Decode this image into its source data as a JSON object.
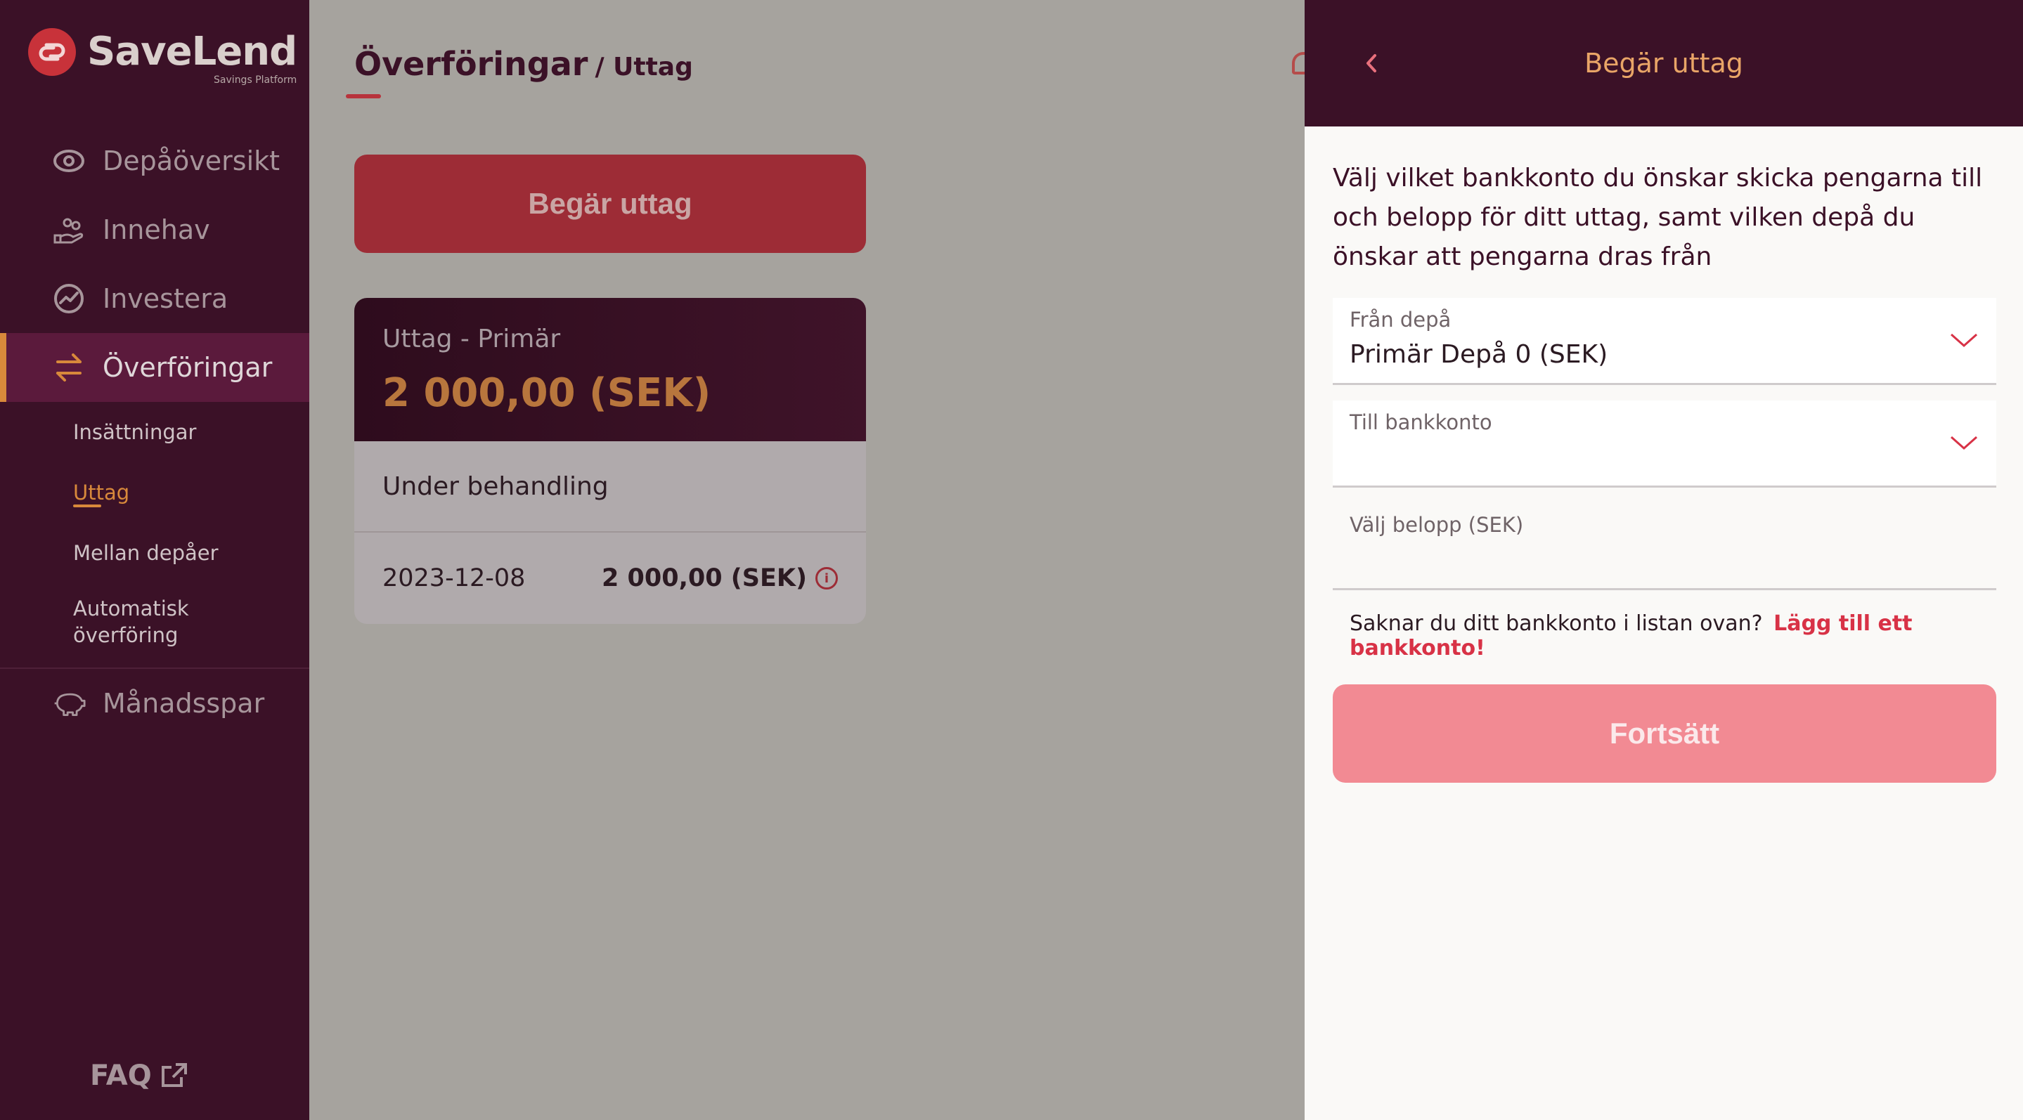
{
  "brand": {
    "name": "SaveLend",
    "tagline": "Savings Platform"
  },
  "sidebar": {
    "items": [
      {
        "label": "Depåöversikt",
        "icon": "eye-icon"
      },
      {
        "label": "Innehav",
        "icon": "hand-coins-icon"
      },
      {
        "label": "Investera",
        "icon": "trend-chart-icon"
      },
      {
        "label": "Överföringar",
        "icon": "transfer-arrows-icon",
        "active": true
      }
    ],
    "subitems": [
      {
        "label": "Insättningar"
      },
      {
        "label": "Uttag",
        "active": true
      },
      {
        "label": "Mellan depåer"
      },
      {
        "label": "Automatisk överföring"
      }
    ],
    "extra_item": {
      "label": "Månadsspar",
      "icon": "piggy-bank-icon"
    },
    "faq": {
      "label": "FAQ",
      "icon": "external-link-icon"
    }
  },
  "main": {
    "breadcrumb": {
      "section": "Överföringar",
      "page": "/ Uttag"
    },
    "request_button": "Begär uttag",
    "card": {
      "title": "Uttag - Primär",
      "amount": "2 000,00 (SEK)",
      "status": "Under behandling",
      "date": "2023-12-08",
      "value": "2 000,00 (SEK)"
    }
  },
  "panel": {
    "title": "Begär uttag",
    "intro": "Välj vilket bankkonto du önskar skicka pengarna till och belopp för ditt uttag, samt vilken depå du önskar att pengarna dras från",
    "from_label": "Från depå",
    "from_value": "Primär Depå 0 (SEK)",
    "to_label": "Till bankkonto",
    "to_value": "",
    "amount_label": "Välj belopp (SEK)",
    "amount_value": "",
    "hint_text": "Saknar du ditt bankkonto i listan ovan?",
    "hint_link": "Lägg till ett bankkonto!",
    "continue_button": "Fortsätt"
  },
  "colors": {
    "sidebar_bg": "#3b1127",
    "accent_orange": "#d8893b",
    "brand_red": "#c8323a",
    "link_red": "#d83246",
    "button_disabled": "#f28a93"
  }
}
